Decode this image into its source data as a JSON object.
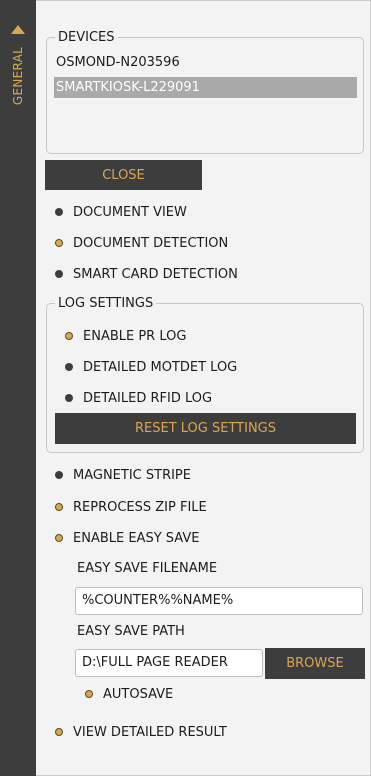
{
  "sidebar": {
    "tab_label": "GENERAL"
  },
  "devices": {
    "legend": "DEVICES",
    "items": [
      {
        "label": "OSMOND-N203596",
        "selected": false
      },
      {
        "label": "SMARTKIOSK-L229091",
        "selected": true
      }
    ]
  },
  "close_label": "CLOSE",
  "options_top": [
    {
      "label": "DOCUMENT VIEW",
      "checked": false
    },
    {
      "label": "DOCUMENT DETECTION",
      "checked": true
    },
    {
      "label": "SMART CARD DETECTION",
      "checked": false
    }
  ],
  "log_settings": {
    "legend": "LOG SETTINGS",
    "options": [
      {
        "label": "ENABLE PR LOG",
        "checked": true
      },
      {
        "label": "DETAILED MOTDET LOG",
        "checked": false
      },
      {
        "label": "DETAILED RFID LOG",
        "checked": false
      }
    ],
    "reset_label": "RESET LOG SETTINGS"
  },
  "options_bottom": [
    {
      "label": "MAGNETIC STRIPE",
      "checked": false
    },
    {
      "label": "REPROCESS ZIP FILE",
      "checked": true
    },
    {
      "label": "ENABLE EASY SAVE",
      "checked": true
    }
  ],
  "easy_save": {
    "filename_label": "EASY SAVE FILENAME",
    "filename_value": "%COUNTER%%NAME%",
    "path_label": "EASY SAVE PATH",
    "path_value": "D:\\FULL PAGE READER",
    "browse_label": "BROWSE",
    "autosave": {
      "label": "AUTOSAVE",
      "checked": true
    }
  },
  "view_detailed_result": {
    "label": "VIEW DETAILED RESULT",
    "checked": true
  },
  "colors": {
    "dark": "#3d3d3d",
    "accent": "#d8a851",
    "selected_row": "#a9a9a9"
  }
}
